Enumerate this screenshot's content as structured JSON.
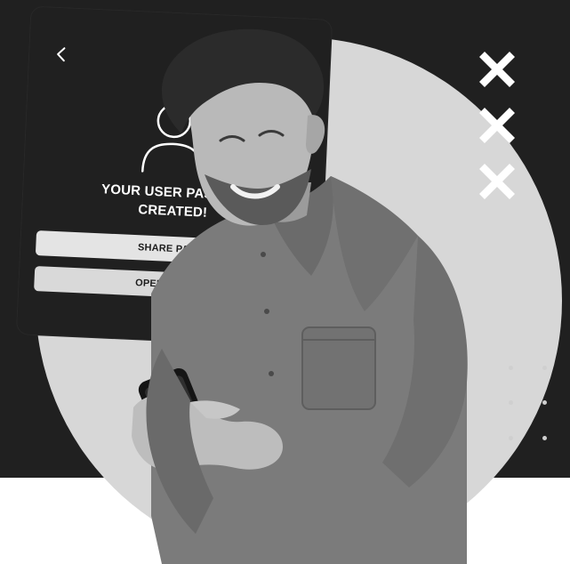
{
  "card": {
    "title_line1": "YOUR USER PASS HA",
    "title_line2": "CREATED!",
    "share_button": "SHARE PASS",
    "open_button": "OPEN IN BRO"
  },
  "icons": {
    "back": "chevron-left-icon",
    "user": "user-icon",
    "decor": "x-cross-icon"
  },
  "colors": {
    "dark_bg": "#202020",
    "circle": "#d7d7d7",
    "button": "#e4e4e4",
    "text_light": "#ffffff",
    "text_dark": "#1d1d1d"
  }
}
